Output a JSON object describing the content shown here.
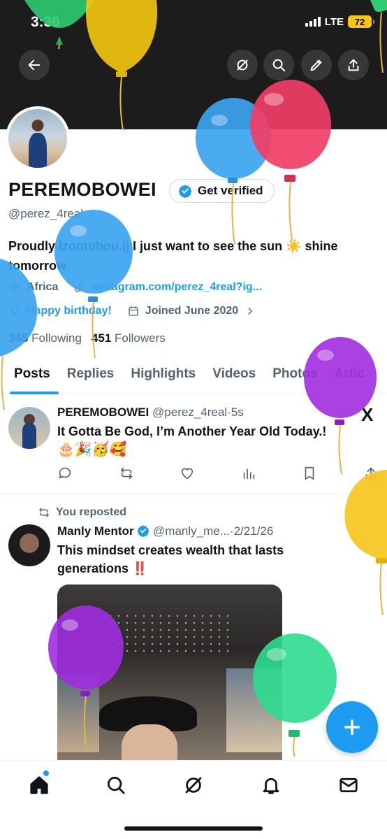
{
  "status_bar": {
    "time": "3:36",
    "network": "LTE",
    "battery": "72"
  },
  "profile": {
    "display_name": "PEREMOBOWEI",
    "verify_label": "Get verified",
    "handle": "@perez_4real",
    "bio": "Proudly Izontubou.|| I just want to see the sun ☀️ shine tomorrow",
    "location": "Africa",
    "website": "instagram.com/perez_4real?ig...",
    "birthday": "Happy birthday!",
    "joined": "Joined June 2020",
    "following_count": "345",
    "following_label": "Following",
    "followers_count": "451",
    "followers_label": "Followers"
  },
  "tabs": [
    "Posts",
    "Replies",
    "Highlights",
    "Videos",
    "Photos",
    "Artic"
  ],
  "posts": [
    {
      "name": "PEREMOBOWEI",
      "handle": "@perez_4real",
      "dot": "·",
      "time": "5s",
      "text": "It Gotta Be God, I’m Another Year Old Today.!",
      "emojis": "🎂🎉🥳🥰"
    },
    {
      "repost_label": "You reposted",
      "name": "Manly Mentor",
      "handle": "@manly_me...",
      "dot": "·",
      "time": "2/21/26",
      "text": "This mindset creates wealth that lasts generations ‼️"
    }
  ],
  "icons": {
    "back": "back-arrow-icon",
    "grok": "grok-icon",
    "search": "search-icon",
    "edit": "edit-icon",
    "share": "share-icon",
    "x_logo": "x-logo-icon"
  },
  "colors": {
    "accent": "#1d9bf0",
    "text": "#0f1419",
    "muted": "#536471",
    "battery": "#f5c518"
  },
  "x_logo_glyph": "X"
}
